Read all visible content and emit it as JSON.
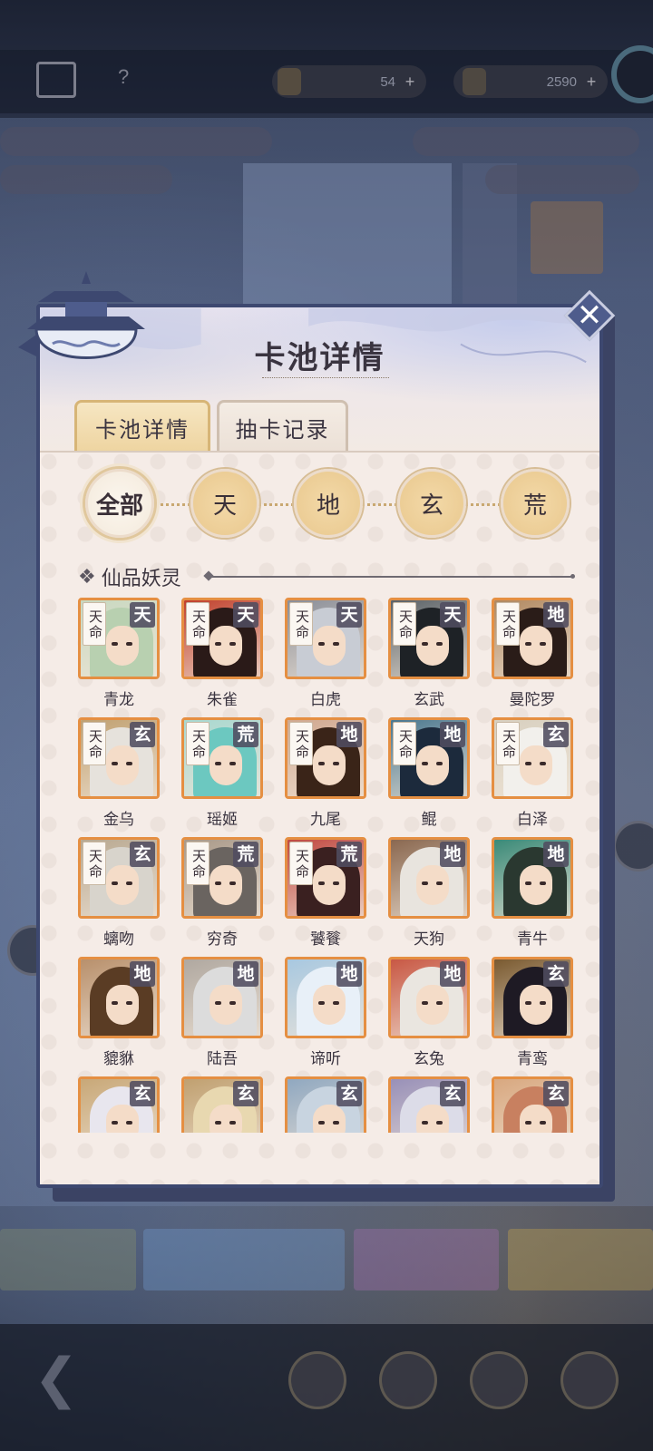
{
  "modal": {
    "title": "卡池详情",
    "close_icon": "close-x-icon",
    "tabs": [
      {
        "label": "卡池详情",
        "active": true
      },
      {
        "label": "抽卡记录",
        "active": false
      }
    ],
    "filters": [
      {
        "label": "全部",
        "active": true
      },
      {
        "label": "天",
        "active": false
      },
      {
        "label": "地",
        "active": false
      },
      {
        "label": "玄",
        "active": false
      },
      {
        "label": "荒",
        "active": false
      }
    ],
    "section": {
      "title": "仙品妖灵",
      "icon": "diamond-ornament-icon"
    },
    "cards": [
      {
        "name": "青龙",
        "tier": "天",
        "destiny": "天命",
        "hair": "#b8d0b0",
        "bg": "#c8d8c0"
      },
      {
        "name": "朱雀",
        "tier": "天",
        "destiny": "天命",
        "hair": "#2a1a18",
        "bg": "#c0402c"
      },
      {
        "name": "白虎",
        "tier": "天",
        "destiny": "天命",
        "hair": "#c8ccd4",
        "bg": "#8a8e98"
      },
      {
        "name": "玄武",
        "tier": "天",
        "destiny": "天命",
        "hair": "#1e2226",
        "bg": "#5a6268"
      },
      {
        "name": "曼陀罗",
        "tier": "地",
        "destiny": "天命",
        "hair": "#2a1c18",
        "bg": "#b08860"
      },
      {
        "name": "金乌",
        "tier": "玄",
        "destiny": "天命",
        "hair": "#e6e2dc",
        "bg": "#c0a070"
      },
      {
        "name": "瑶姬",
        "tier": "荒",
        "destiny": "天命",
        "hair": "#6cc8c0",
        "bg": "#a8d8d0"
      },
      {
        "name": "九尾",
        "tier": "地",
        "destiny": "天命",
        "hair": "#3a2418",
        "bg": "#d0a890"
      },
      {
        "name": "鲲",
        "tier": "地",
        "destiny": "天命",
        "hair": "#1c2a3c",
        "bg": "#4a7890"
      },
      {
        "name": "白泽",
        "tier": "玄",
        "destiny": "天命",
        "hair": "#f2f0ec",
        "bg": "#d8d0c0"
      },
      {
        "name": "螭吻",
        "tier": "玄",
        "destiny": "天命",
        "hair": "#d8d4cc",
        "bg": "#b8a890"
      },
      {
        "name": "穷奇",
        "tier": "荒",
        "destiny": "天命",
        "hair": "#6a6460",
        "bg": "#a89888"
      },
      {
        "name": "饕餮",
        "tier": "荒",
        "destiny": "天命",
        "hair": "#3a2020",
        "bg": "#c04840"
      },
      {
        "name": "天狗",
        "tier": "地",
        "destiny": "",
        "hair": "#e8e4de",
        "bg": "#8a6850"
      },
      {
        "name": "青牛",
        "tier": "地",
        "destiny": "",
        "hair": "#2a3830",
        "bg": "#3a8a78"
      },
      {
        "name": "貔貅",
        "tier": "地",
        "destiny": "",
        "hair": "#5a3c24",
        "bg": "#b8906c"
      },
      {
        "name": "陆吾",
        "tier": "地",
        "destiny": "",
        "hair": "#dcdcdc",
        "bg": "#b0a8a0"
      },
      {
        "name": "谛听",
        "tier": "地",
        "destiny": "",
        "hair": "#e8f0f8",
        "bg": "#a8c8e0"
      },
      {
        "name": "玄兔",
        "tier": "地",
        "destiny": "",
        "hair": "#eae6e0",
        "bg": "#c85844"
      },
      {
        "name": "青鸾",
        "tier": "玄",
        "destiny": "",
        "hair": "#1e1a24",
        "bg": "#7a5a30"
      },
      {
        "name": "",
        "tier": "玄",
        "destiny": "",
        "hair": "#e8e6ee",
        "bg": "#c8a878"
      },
      {
        "name": "",
        "tier": "玄",
        "destiny": "",
        "hair": "#e8d8b0",
        "bg": "#c0a070"
      },
      {
        "name": "",
        "tier": "玄",
        "destiny": "",
        "hair": "#c8d4e0",
        "bg": "#90a8c0"
      },
      {
        "name": "",
        "tier": "玄",
        "destiny": "",
        "hair": "#dcdce8",
        "bg": "#9890b8"
      },
      {
        "name": "",
        "tier": "玄",
        "destiny": "",
        "hair": "#c88060",
        "bg": "#d8a880"
      }
    ]
  },
  "background": {
    "currency_1": "54",
    "currency_2": "2590",
    "help_icon": "question-mark-icon",
    "home_icon": "home-icon",
    "back_icon": "back-arrow-icon"
  }
}
